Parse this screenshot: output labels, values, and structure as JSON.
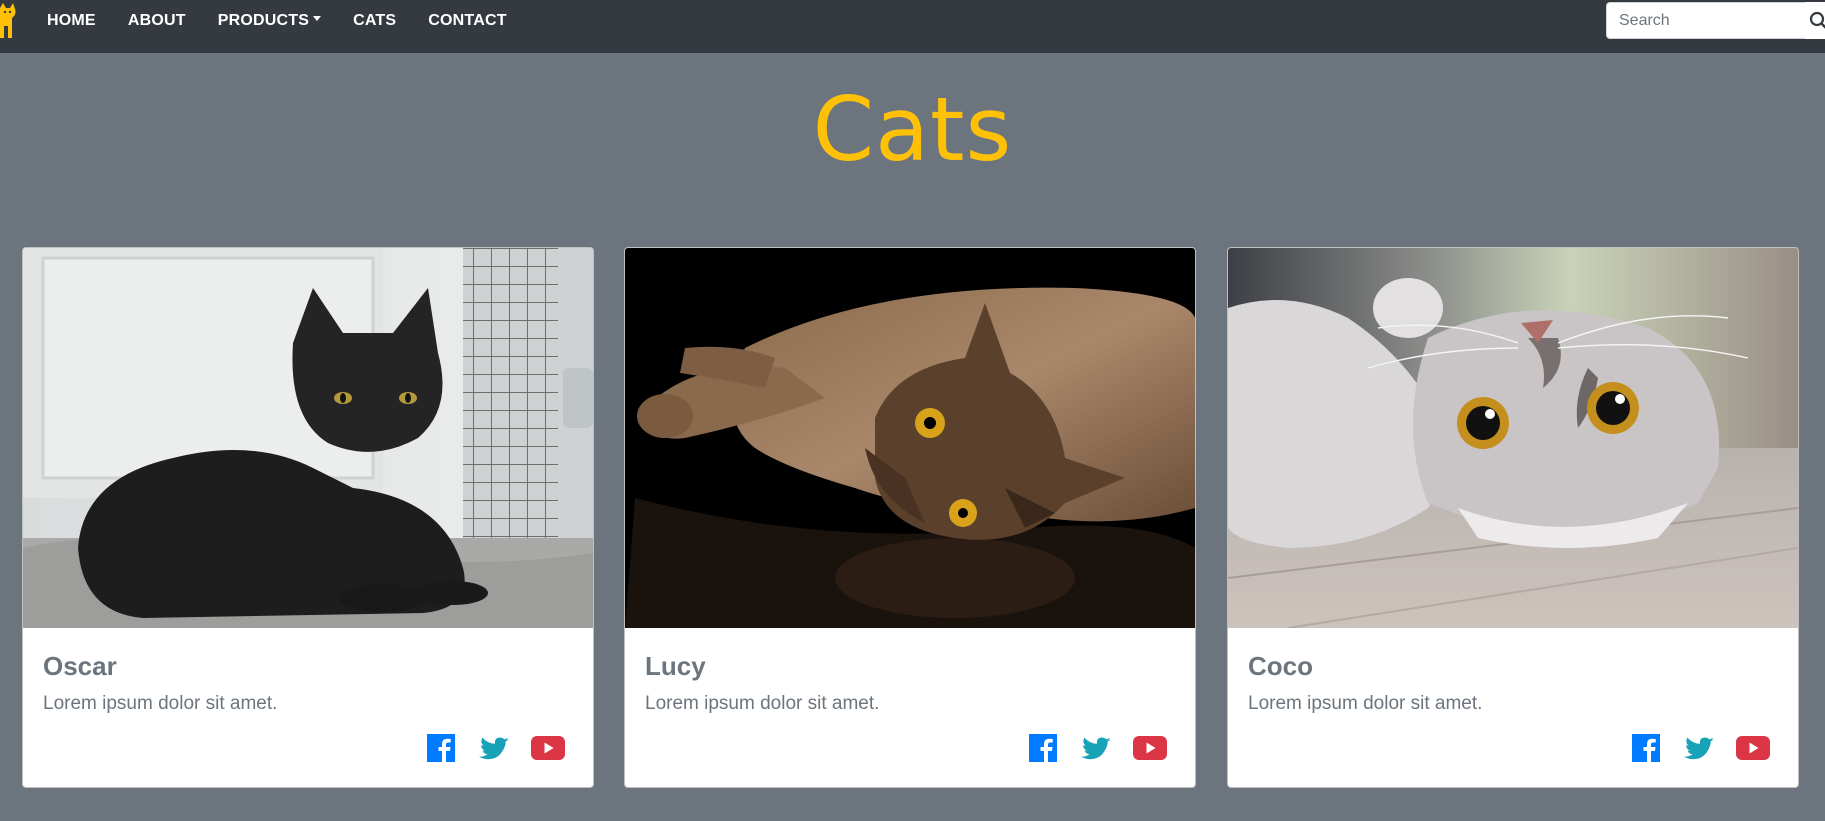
{
  "nav": {
    "links": [
      {
        "label": "HOME"
      },
      {
        "label": "ABOUT"
      },
      {
        "label": "PRODUCTS",
        "has_dropdown": true
      },
      {
        "label": "CATS"
      },
      {
        "label": "CONTACT"
      }
    ],
    "search_placeholder": "Search"
  },
  "page": {
    "title": "Cats"
  },
  "cards": [
    {
      "name": "Oscar",
      "text": "Lorem ipsum dolor sit amet.",
      "image": "black cat lying on a grey rug beside a cage"
    },
    {
      "name": "Lucy",
      "text": "Lorem ipsum dolor sit amet.",
      "image": "brown cat lying on a black reflective surface"
    },
    {
      "name": "Coco",
      "text": "Lorem ipsum dolor sit amet.",
      "image": "grey tabby cat lying upside down on a wooden floor"
    }
  ],
  "social_icons": [
    "facebook-icon",
    "twitter-icon",
    "youtube-icon"
  ],
  "colors": {
    "navbar": "#343a40",
    "background": "#6c757d",
    "title": "#ffc107",
    "facebook": "#007bff",
    "twitter": "#17a2b8",
    "youtube": "#dc3545"
  }
}
